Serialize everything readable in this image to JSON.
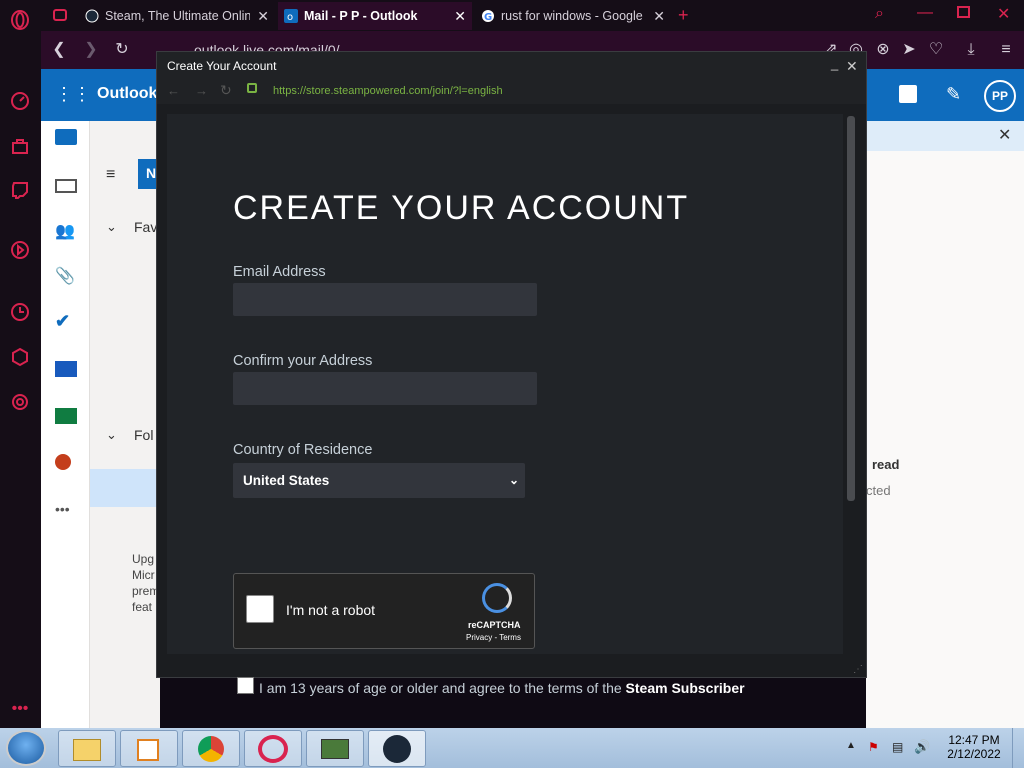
{
  "browser": {
    "tabs": [
      {
        "label": "Steam, The Ultimate Online",
        "icon": "steam-icon"
      },
      {
        "label": "Mail - P P - Outlook",
        "icon": "outlook-icon",
        "active": true
      },
      {
        "label": "rust for windows - Google",
        "icon": "google-icon"
      }
    ],
    "address": "outlook.live.com/mail/0/",
    "new_tab": "+"
  },
  "outlook": {
    "app_name": "Outlook",
    "avatar": "PP",
    "new_button": "N",
    "nav": [
      "Fav",
      "Fol"
    ],
    "upgrade_text": [
      "Upg",
      "Micr",
      "prem",
      "feat"
    ],
    "right_texts": [
      "read",
      "cted"
    ]
  },
  "popup": {
    "title": "Create Your Account",
    "url": "https://store.steampowered.com/join/?l=english",
    "heading": "CREATE YOUR ACCOUNT",
    "email_label": "Email Address",
    "confirm_label": "Confirm your Address",
    "country_label": "Country of Residence",
    "country_value": "United States",
    "captcha_label": "I'm not a robot",
    "captcha_brand": "reCAPTCHA",
    "captcha_links": "Privacy - Terms",
    "agree_text": "I am 13 years of age or older and agree to the terms of the ",
    "agree_bold": "Steam Subscriber"
  },
  "taskbar": {
    "time": "12:47 PM",
    "date": "2/12/2022"
  }
}
